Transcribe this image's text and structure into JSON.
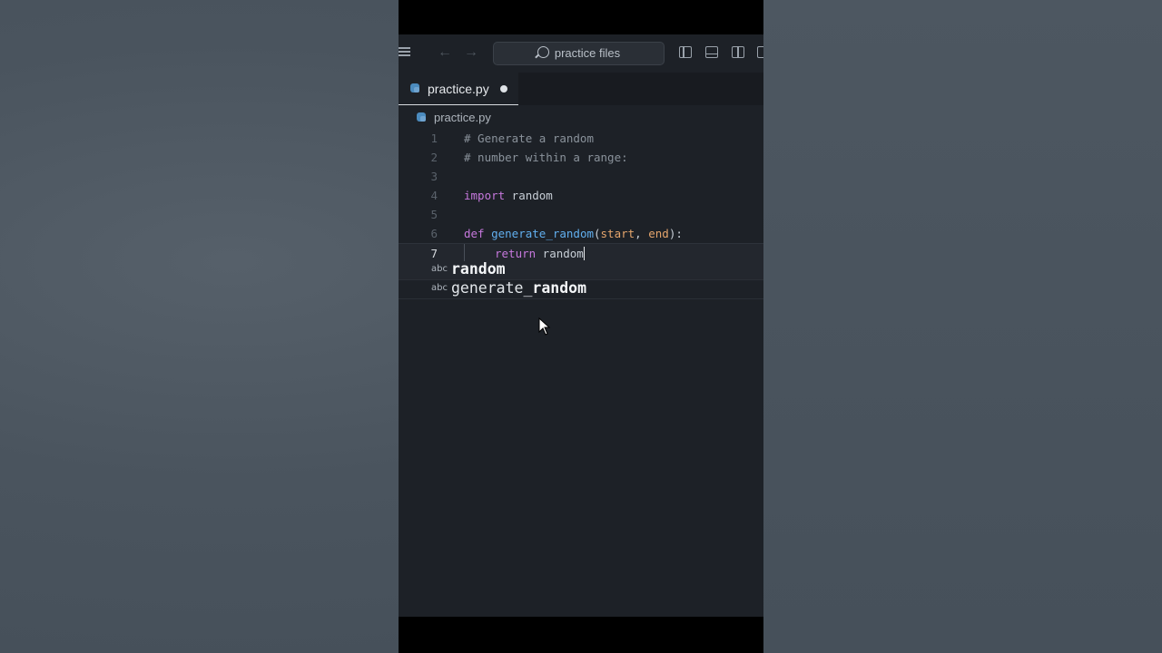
{
  "titlebar": {
    "search_text": "practice files"
  },
  "tab": {
    "label": "practice.py",
    "unsaved": true
  },
  "breadcrumb": {
    "file": "practice.py"
  },
  "code": {
    "lines": [
      {
        "n": "1",
        "text": "# Generate a random"
      },
      {
        "n": "2",
        "text": "# number within a range:"
      },
      {
        "n": "3",
        "text": ""
      },
      {
        "n": "4",
        "kw": "import",
        "rest": " random"
      },
      {
        "n": "5",
        "text": ""
      },
      {
        "n": "6",
        "kw": "def",
        "fn": "generate_random",
        "p1": "start",
        "p2": "end",
        "tail": "):"
      },
      {
        "n": "7",
        "kw": "return",
        "rest": " random"
      }
    ],
    "active_line": "7"
  },
  "suggestions": [
    {
      "kind": "abc",
      "label": "random"
    },
    {
      "kind": "abc",
      "label_plain": "generate_",
      "label_match": "random"
    }
  ],
  "colors": {
    "editor_bg": "#1d2127",
    "keyword": "#c678dd",
    "function": "#61afef",
    "parameter": "#e5a56c",
    "comment": "#8a929b"
  }
}
